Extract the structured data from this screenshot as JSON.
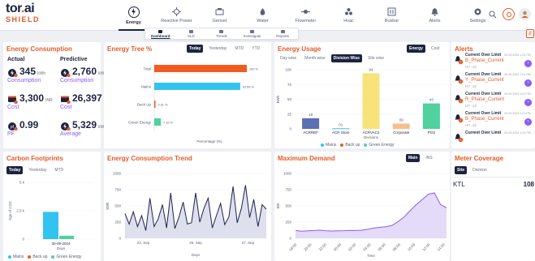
{
  "logo": {
    "tor": "tor",
    "dot": ".",
    "ai": "ai",
    "shield": "SHIELD"
  },
  "nav": [
    {
      "label": "Energy",
      "icon": "energy-icon",
      "active": true
    },
    {
      "label": "Reactive Power",
      "icon": "reactive-power-icon"
    },
    {
      "label": "Genset",
      "icon": "genset-icon"
    },
    {
      "label": "Water",
      "icon": "water-icon"
    },
    {
      "label": "Flowmeter",
      "icon": "flowmeter-icon"
    },
    {
      "label": "Hvac",
      "icon": "hvac-icon"
    },
    {
      "label": "Busbar",
      "icon": "busbar-icon"
    },
    {
      "label": "Alerts",
      "icon": "alerts-icon"
    },
    {
      "label": "Settings",
      "icon": "settings-icon"
    }
  ],
  "subnav": [
    {
      "label": "Dashboard",
      "active": true
    },
    {
      "label": "SLD"
    },
    {
      "label": "Trends"
    },
    {
      "label": "Investigate"
    },
    {
      "label": "Reports"
    }
  ],
  "energy_consumption": {
    "title": "Energy Consumption",
    "actual_label": "Actual",
    "predictive_label": "Predictive",
    "actual": [
      {
        "value": "345",
        "unit": "kWh",
        "label": "Consumption"
      },
      {
        "value": "3,300",
        "unit": "INR",
        "label": "Cost"
      },
      {
        "value": "0.99",
        "unit": "",
        "label": "PF"
      }
    ],
    "predictive": [
      {
        "value": "2,760",
        "unit": "kWh",
        "label": "Consumption"
      },
      {
        "value": "26,397",
        "unit": "INR",
        "label": "Cost"
      },
      {
        "value": "5,329",
        "unit": "kWh",
        "label": "Average"
      }
    ]
  },
  "energy_tree": {
    "title": "Energy Tree %",
    "tabs": [
      "Today",
      "Yesterday",
      "MTD",
      "YTD"
    ],
    "active_tab": "Today",
    "xlabel": "Percentage (%)"
  },
  "energy_usage": {
    "title": "Energy Usage",
    "tabs": [
      "Day wise",
      "Month wise",
      "Division Wise",
      "Site wise"
    ],
    "active_tab": "Division Wise",
    "toggle": [
      "Energy",
      "Cost"
    ],
    "active_toggle": "Energy",
    "xlabel": "Divisions",
    "ylabel": "kWh"
  },
  "alerts": {
    "title": "Alerts",
    "items": [
      {
        "title": "Current Over Limit",
        "time": "30-09-2024 1:01 PM",
        "name": "B_Phase_Current",
        "sub": "HY -12"
      },
      {
        "title": "Current Over Limit",
        "time": "30-09-2024 1:01 PM",
        "name": "Y_Phase_Current",
        "sub": "HY -12"
      },
      {
        "title": "Current Over Limit",
        "time": "30-09-2024 1:01 PM",
        "name": "R_Phase_Current",
        "sub": "HY -12"
      },
      {
        "title": "Current Over Limit",
        "time": "30-09-2024 1:01 PM",
        "name": "B_Phase_Current",
        "sub": "HY -12"
      },
      {
        "title": "Current Over Limit",
        "time": "30-09-2024 1:01 PM",
        "name": "",
        "sub": ""
      }
    ]
  },
  "carbon": {
    "title": "Carbon Footprints",
    "tabs": [
      "Today",
      "Yesterday",
      "MTD"
    ],
    "active_tab": "Today",
    "ylabel": "Kgs of CO2",
    "xlabel": "Days"
  },
  "trend": {
    "title": "Energy Consumption Trend",
    "xlabel": "Days",
    "ylabel": "kWh"
  },
  "max_demand": {
    "title": "Maximum Demand",
    "tabs": [
      "Main",
      "INS"
    ],
    "active_tab": "Main",
    "xlabel": "Time",
    "ylabel": "kW"
  },
  "meter": {
    "title": "Meter Coverage",
    "tabs": [
      "Site",
      "Division"
    ],
    "active_tab": "Site",
    "row_label": "KTL",
    "row_value": "108"
  },
  "legend": [
    {
      "label": "Mains",
      "color": "#33c3f0"
    },
    {
      "label": "Back up",
      "color": "#e45b2a"
    },
    {
      "label": "Green Energy",
      "color": "#4fd1a0"
    }
  ],
  "chart_data": [
    {
      "type": "bar",
      "orientation": "horizontal",
      "title": "Energy Tree %",
      "categories": [
        "Total",
        "Mains",
        "Back Up",
        "Green Energy"
      ],
      "values": [
        100,
        92.89,
        0.31,
        7.16
      ],
      "value_labels": [
        "100 %",
        "92.89 %",
        "0.31 %",
        "7.16 %"
      ],
      "colors": [
        "#f25c1f",
        "#33c3f0",
        "#e45b2a",
        "#4fd1a0"
      ],
      "xlabel": "Percentage (%)",
      "xlim": [
        0,
        100
      ]
    },
    {
      "type": "bar",
      "title": "Energy Usage",
      "categories": [
        "ACRREF",
        "ACR Store",
        "ACRVAC2",
        "Corporate",
        "PGS"
      ],
      "values": [
        18,
        1,
        94,
        9,
        43
      ],
      "value_labels": [
        "18",
        "01",
        "94",
        "09",
        "43"
      ],
      "colors": [
        "#5b6fb5",
        "#33c3f0",
        "#f8e27a",
        "#f7c08a",
        "#4fd1a0"
      ],
      "xlabel": "Divisions",
      "ylabel": "kWh",
      "ylim": [
        0,
        100
      ],
      "yticks": [
        0,
        25,
        50,
        75,
        100
      ]
    },
    {
      "type": "bar",
      "title": "Carbon Footprints",
      "stacked": true,
      "categories": [
        "30-09-2024"
      ],
      "series": [
        {
          "name": "Mains",
          "values": [
            2400
          ],
          "color": "#33c3f0"
        },
        {
          "name": "Green Energy",
          "values": [
            300
          ],
          "color": "#4fd1a0"
        }
      ],
      "xlabel": "Days",
      "ylabel": "Kgs of CO2",
      "ylim": [
        0,
        5000
      ],
      "yticks": [
        0,
        2500,
        5000
      ],
      "ytick_labels": [
        "0",
        "2.5 k",
        "5 k"
      ]
    },
    {
      "type": "area",
      "title": "Energy Consumption Trend",
      "x_labels": [
        "23. Sep",
        "25. Sep",
        "27. Sep"
      ],
      "values": [
        380,
        220,
        410,
        180,
        350,
        120,
        620,
        180,
        300,
        520,
        160,
        700,
        150,
        330,
        560,
        220,
        240,
        700,
        250,
        460,
        620,
        160,
        350,
        540,
        210,
        330,
        800,
        240,
        460,
        820,
        320,
        600,
        180,
        520,
        450
      ],
      "xlabel": "Days",
      "ylabel": "kWh",
      "ylim": [
        0,
        1000
      ],
      "yticks": [
        0,
        250,
        500,
        750,
        1000
      ]
    },
    {
      "type": "area",
      "title": "Maximum Demand",
      "x_labels": [
        "18:00",
        "20:00",
        "22:00",
        "00:00",
        "02:00",
        "04:00",
        "06:00",
        "08:00",
        "10:00",
        "12:00",
        "14:00"
      ],
      "values": [
        120,
        110,
        115,
        120,
        125,
        118,
        112,
        115,
        118,
        122,
        120,
        125,
        140,
        160,
        170,
        180,
        200,
        260,
        330,
        430,
        520,
        600,
        680,
        700,
        520,
        470
      ],
      "xlabel": "Time",
      "ylabel": "kW",
      "ylim": [
        0,
        1000
      ],
      "yticks": [
        0,
        250,
        500,
        750,
        1000
      ]
    }
  ]
}
